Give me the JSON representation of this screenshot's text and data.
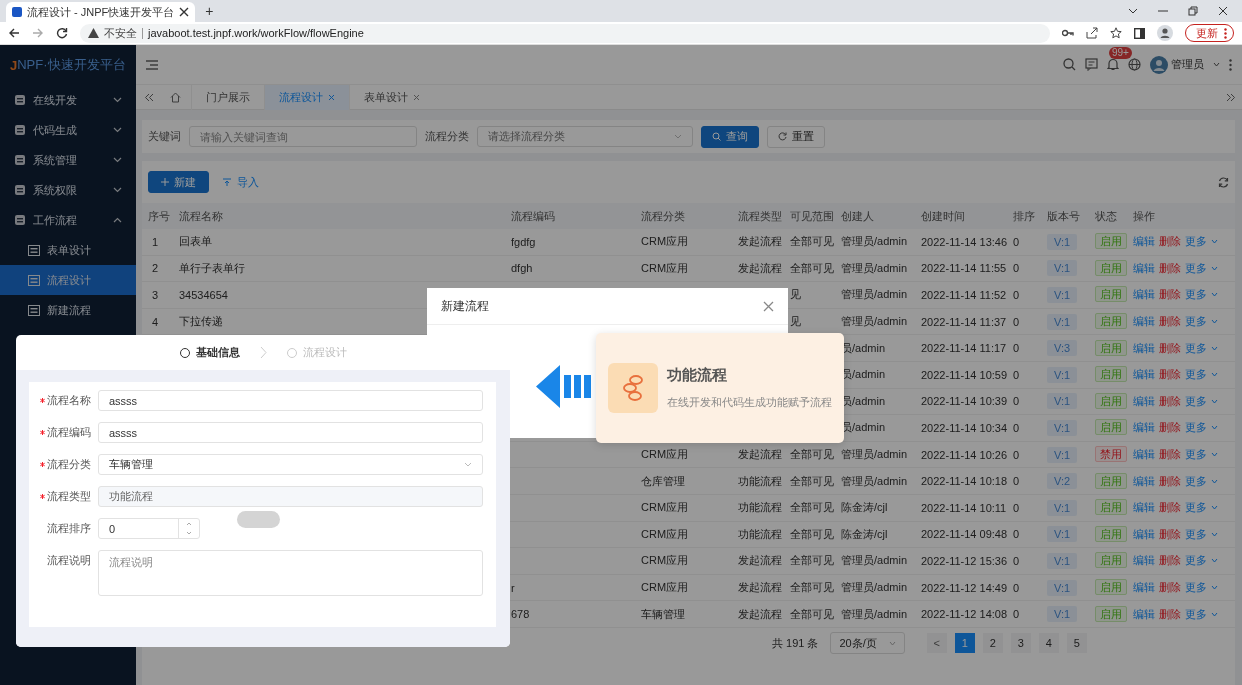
{
  "browser": {
    "tab_title": "流程设计 - JNPF快速开发平台",
    "new_tab": "+",
    "security": "不安全",
    "url": "javaboot.test.jnpf.work/workFlow/flowEngine",
    "update_button": "更新"
  },
  "app": {
    "logo_j": "J",
    "logo_rest": "NPF·快速开发平台",
    "notification_badge": "99+",
    "user": "管理员"
  },
  "sidebar": {
    "items": [
      {
        "label": "在线开发",
        "expanded": false
      },
      {
        "label": "代码生成",
        "expanded": false
      },
      {
        "label": "系统管理",
        "expanded": false
      },
      {
        "label": "系统权限",
        "expanded": false
      },
      {
        "label": "工作流程",
        "expanded": true,
        "children": [
          {
            "label": "表单设计",
            "selected": false
          },
          {
            "label": "流程设计",
            "selected": true
          },
          {
            "label": "新建流程",
            "selected": false
          }
        ]
      }
    ]
  },
  "tabs": [
    {
      "label": "门户展示",
      "selected": false,
      "closable": false
    },
    {
      "label": "流程设计",
      "selected": true,
      "closable": true
    },
    {
      "label": "表单设计",
      "selected": false,
      "closable": true
    }
  ],
  "search": {
    "keyword_label": "关键词",
    "keyword_placeholder": "请输入关键词查询",
    "category_label": "流程分类",
    "category_placeholder": "请选择流程分类",
    "query_button": "查询",
    "reset_button": "重置"
  },
  "toolbar": {
    "new_button": "新建",
    "import_button": "导入"
  },
  "table": {
    "columns": [
      "序号",
      "流程名称",
      "流程编码",
      "流程分类",
      "流程类型",
      "可见范围",
      "创建人",
      "创建时间",
      "排序",
      "版本号",
      "状态",
      "操作"
    ],
    "rows": [
      {
        "index": "1",
        "name": "回表单",
        "code": "fgdfg",
        "category": "CRM应用",
        "type": "发起流程",
        "scope": "全部可见",
        "creator": "管理员/admin",
        "time": "2022-11-14 13:46",
        "sort": "0",
        "version": "V:1",
        "status": "启用",
        "enabled": true,
        "actions": [
          "编辑",
          "删除",
          "更多"
        ]
      },
      {
        "index": "2",
        "name": "单行子表单行",
        "code": "dfgh",
        "category": "CRM应用",
        "type": "发起流程",
        "scope": "全部可见",
        "creator": "管理员/admin",
        "time": "2022-11-14 11:55",
        "sort": "0",
        "version": "V:1",
        "status": "启用",
        "enabled": true,
        "actions": [
          "编辑",
          "删除",
          "更多"
        ]
      },
      {
        "index": "3",
        "name": "34534654",
        "scope": "见",
        "creator": "管理员/admin",
        "time": "2022-11-14 11:52",
        "sort": "0",
        "version": "V:1",
        "status": "启用",
        "enabled": true,
        "actions": [
          "编辑",
          "删除",
          "更多"
        ]
      },
      {
        "index": "4",
        "name": "下拉传递",
        "scope": "见",
        "creator": "管理员/admin",
        "time": "2022-11-14 11:37",
        "sort": "0",
        "version": "V:1",
        "status": "启用",
        "enabled": true,
        "actions": [
          "编辑",
          "删除",
          "更多"
        ]
      },
      {
        "creator": "员/admin",
        "time": "2022-11-14 11:17",
        "sort": "0",
        "version": "V:3",
        "status": "启用",
        "enabled": true,
        "actions": [
          "编辑",
          "删除",
          "更多"
        ]
      },
      {
        "creator": "员/admin",
        "time": "2022-11-14 10:59",
        "sort": "0",
        "version": "V:1",
        "status": "启用",
        "enabled": true,
        "actions": [
          "编辑",
          "删除",
          "更多"
        ]
      },
      {
        "creator": "员/admin",
        "time": "2022-11-14 10:39",
        "sort": "0",
        "version": "V:1",
        "status": "启用",
        "enabled": true,
        "actions": [
          "编辑",
          "删除",
          "更多"
        ]
      },
      {
        "creator": "员/admin",
        "time": "2022-11-14 10:34",
        "sort": "0",
        "version": "V:1",
        "status": "启用",
        "enabled": true,
        "actions": [
          "编辑",
          "删除",
          "更多"
        ]
      },
      {
        "category": "CRM应用",
        "type": "发起流程",
        "scope": "全部可见",
        "creator": "管理员/admin",
        "time": "2022-11-14 10:26",
        "sort": "0",
        "version": "V:1",
        "status": "禁用",
        "enabled": false,
        "actions": [
          "编辑",
          "删除",
          "更多"
        ]
      },
      {
        "category": "仓库管理",
        "type": "功能流程",
        "scope": "全部可见",
        "creator": "管理员/admin",
        "time": "2022-11-14 10:18",
        "sort": "0",
        "version": "V:2",
        "status": "启用",
        "enabled": true,
        "actions": [
          "编辑",
          "删除",
          "更多"
        ]
      },
      {
        "category": "CRM应用",
        "type": "功能流程",
        "scope": "全部可见",
        "creator": "陈金涛/cjl",
        "time": "2022-11-14 10:11",
        "sort": "0",
        "version": "V:1",
        "status": "启用",
        "enabled": true,
        "actions": [
          "编辑",
          "删除",
          "更多"
        ]
      },
      {
        "category": "CRM应用",
        "type": "功能流程",
        "scope": "全部可见",
        "creator": "陈金涛/cjl",
        "time": "2022-11-14 09:48",
        "sort": "0",
        "version": "V:1",
        "status": "启用",
        "enabled": true,
        "actions": [
          "编辑",
          "删除",
          "更多"
        ]
      },
      {
        "category": "CRM应用",
        "type": "发起流程",
        "scope": "全部可见",
        "creator": "管理员/admin",
        "time": "2022-11-12 15:36",
        "sort": "0",
        "version": "V:1",
        "status": "启用",
        "enabled": true,
        "actions": [
          "编辑",
          "删除",
          "更多"
        ]
      },
      {
        "code": "r",
        "category": "CRM应用",
        "type": "发起流程",
        "scope": "全部可见",
        "creator": "管理员/admin",
        "time": "2022-11-12 14:49",
        "sort": "0",
        "version": "V:1",
        "status": "启用",
        "enabled": true,
        "actions": [
          "编辑",
          "删除",
          "更多"
        ]
      },
      {
        "code": "678",
        "category": "车辆管理",
        "type": "发起流程",
        "scope": "全部可见",
        "creator": "管理员/admin",
        "time": "2022-11-12 14:08",
        "sort": "0",
        "version": "V:1",
        "status": "启用",
        "enabled": true,
        "actions": [
          "编辑",
          "删除",
          "更多"
        ]
      }
    ]
  },
  "pagination": {
    "total": "共 191 条",
    "page_size": "20条/页",
    "prev": "<",
    "pages": [
      {
        "label": "1",
        "selected": true
      },
      {
        "label": "2",
        "selected": false
      },
      {
        "label": "3",
        "selected": false
      },
      {
        "label": "4",
        "selected": false
      },
      {
        "label": "5",
        "selected": false
      }
    ]
  },
  "dialog": {
    "title": "新建流程"
  },
  "flow_type_card": {
    "title": "功能流程",
    "description": "在线开发和代码生成功能赋予流程"
  },
  "form_panel": {
    "steps": [
      {
        "label": "基础信息",
        "selected": true
      },
      {
        "label": "流程设计",
        "selected": false
      }
    ],
    "fields": [
      {
        "kind": "text",
        "label": "流程名称",
        "required": true,
        "value": "assss"
      },
      {
        "kind": "text",
        "label": "流程编码",
        "required": true,
        "value": "assss"
      },
      {
        "kind": "select",
        "label": "流程分类",
        "required": true,
        "value": "车辆管理"
      },
      {
        "kind": "disabled",
        "label": "流程类型",
        "required": true,
        "value": "功能流程"
      },
      {
        "kind": "number",
        "label": "流程排序",
        "required": false,
        "value": "0"
      },
      {
        "kind": "textarea",
        "label": "流程说明",
        "required": false,
        "placeholder": "流程说明"
      }
    ]
  }
}
